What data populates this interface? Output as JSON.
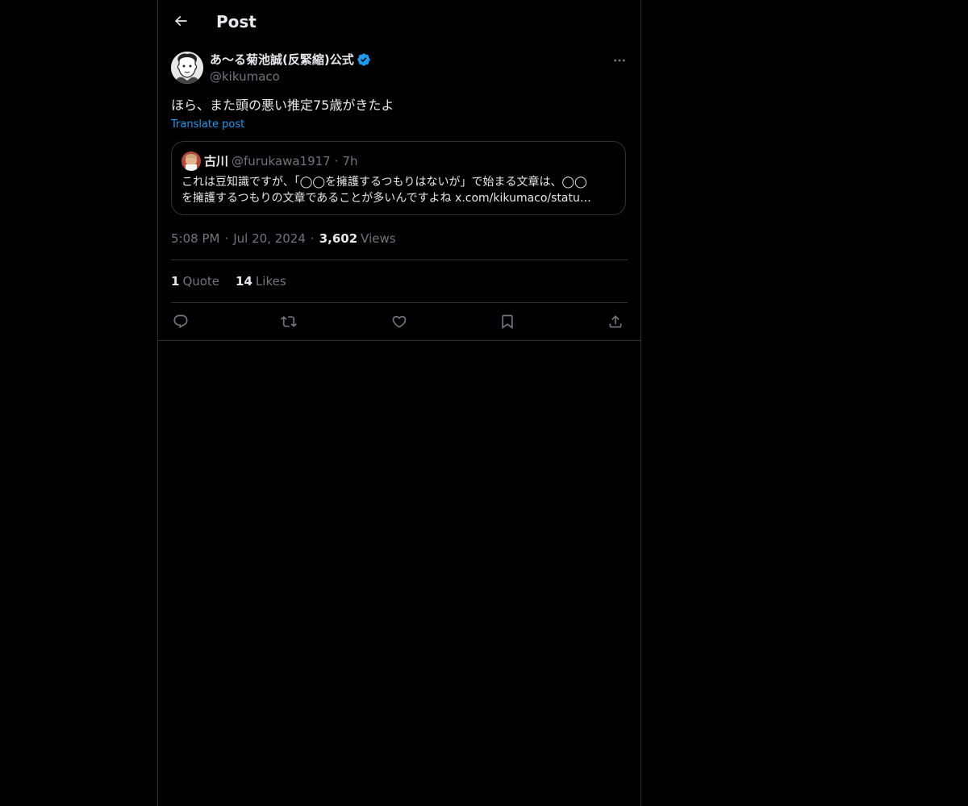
{
  "header": {
    "title": "Post",
    "back_icon": "arrow-left-icon"
  },
  "post": {
    "author": {
      "display_name": "あ〜る菊池誠(反緊縮)公式",
      "handle": "@kikumaco",
      "verified": true,
      "verified_color": "#1d9bf0"
    },
    "text": "ほら、また頭の悪い推定75歳がきたよ",
    "translate_label": "Translate post",
    "quoted": {
      "display_name": "古川",
      "handle": "@furukawa1917",
      "separator": "·",
      "time": "7h",
      "text_line1": "これは豆知識ですが、「◯◯を擁護するつもりはないが」で始まる文章は、◯◯",
      "text_line2": "を擁護するつもりの文章であることが多いんですよね x.com/kikumaco/statu…"
    },
    "time": "5:08 PM",
    "date": "Jul 20, 2024",
    "views_count": "3,602",
    "views_label": "Views",
    "separator": "·",
    "stats": {
      "quotes_count": "1",
      "quotes_label": "Quote",
      "likes_count": "14",
      "likes_label": "Likes"
    },
    "actions": [
      "reply-icon",
      "repost-icon",
      "like-icon",
      "bookmark-icon",
      "share-icon"
    ]
  },
  "colors": {
    "background": "#000000",
    "text": "#e7e9ea",
    "secondary": "#71767b",
    "accent": "#1d9bf0",
    "border": "#2f3336"
  }
}
